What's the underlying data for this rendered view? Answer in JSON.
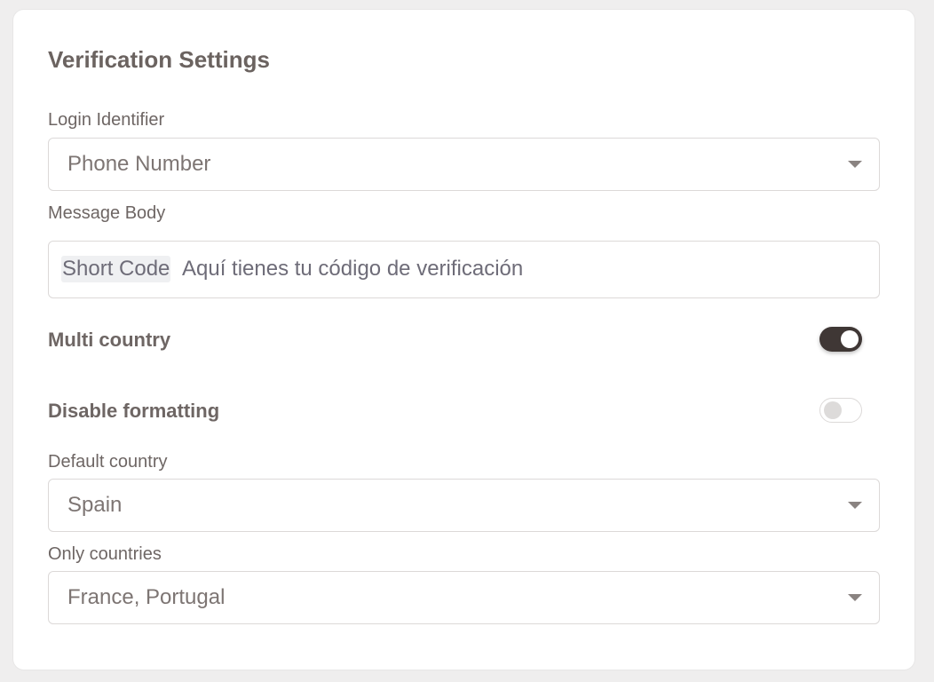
{
  "title": "Verification Settings",
  "login_identifier": {
    "label": "Login Identifier",
    "value": "Phone Number"
  },
  "message_body": {
    "label": "Message Body",
    "token": "Short Code",
    "text": "Aquí tienes tu código de verificación"
  },
  "multi_country": {
    "label": "Multi country",
    "enabled": true
  },
  "disable_formatting": {
    "label": "Disable formatting",
    "enabled": false
  },
  "default_country": {
    "label": "Default country",
    "value": "Spain"
  },
  "only_countries": {
    "label": "Only countries",
    "value": "France, Portugal"
  },
  "colors": {
    "toggle_on": "#3f3735",
    "text": "#6e6664",
    "border": "#dcd9d8"
  }
}
